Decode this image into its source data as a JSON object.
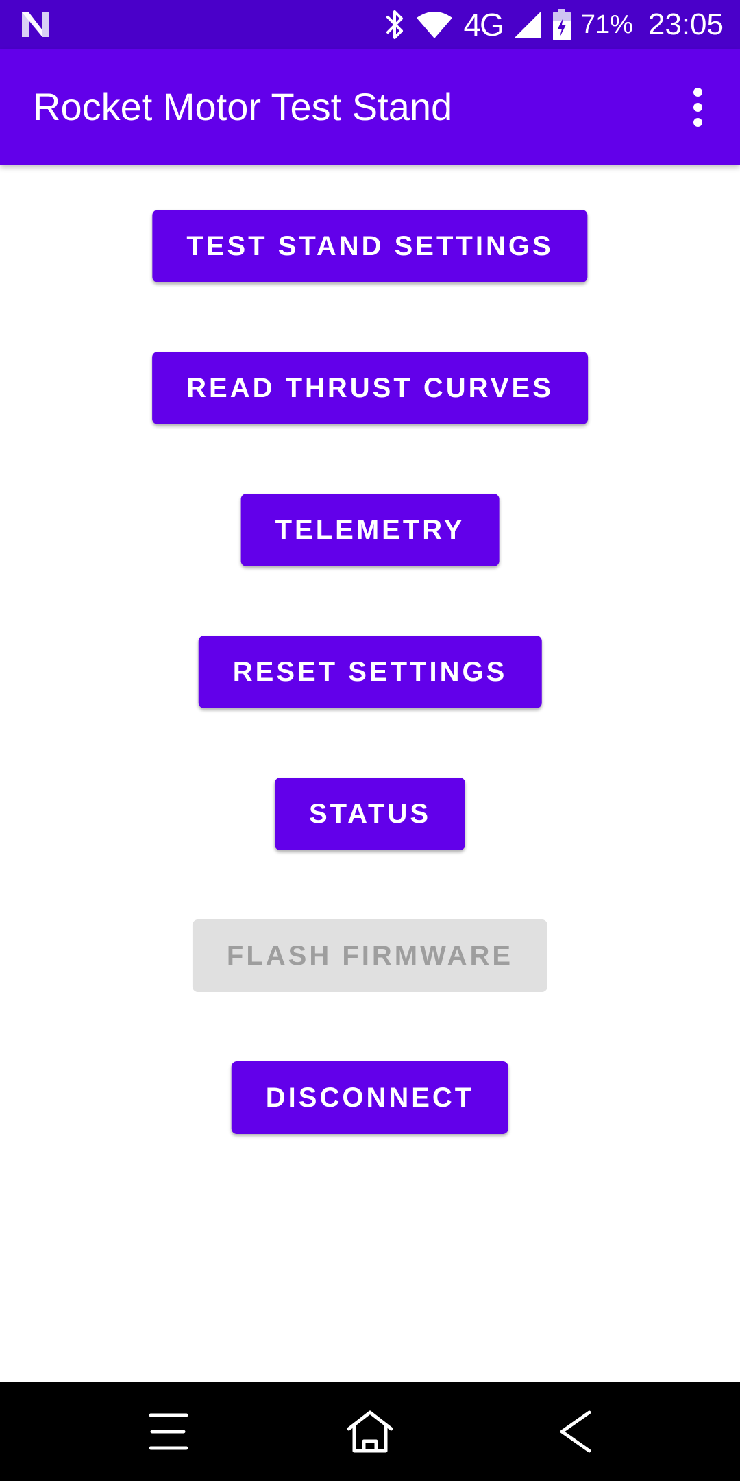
{
  "status_bar": {
    "network_type": "4G",
    "battery_percent": "71%",
    "time": "23:05",
    "icons": [
      "n-notification-icon",
      "bluetooth-icon",
      "wifi-icon",
      "cellular-signal-icon",
      "battery-charging-icon"
    ]
  },
  "app_bar": {
    "title": "Rocket Motor Test Stand",
    "menu_icon": "more-vert-icon"
  },
  "buttons": [
    {
      "label": "TEST STAND SETTINGS",
      "enabled": true
    },
    {
      "label": "READ THRUST CURVES",
      "enabled": true
    },
    {
      "label": "TELEMETRY",
      "enabled": true
    },
    {
      "label": "RESET SETTINGS",
      "enabled": true
    },
    {
      "label": "STATUS",
      "enabled": true
    },
    {
      "label": "FLASH FIRMWARE",
      "enabled": false
    },
    {
      "label": "DISCONNECT",
      "enabled": true
    }
  ],
  "nav_bar": {
    "icons": [
      "recent-apps-icon",
      "home-icon",
      "back-icon"
    ]
  },
  "colors": {
    "status_bar": "#4a00c9",
    "primary": "#6200ea",
    "disabled_bg": "#e0e0e0",
    "disabled_text": "#9e9e9e",
    "nav_bar": "#000000"
  }
}
